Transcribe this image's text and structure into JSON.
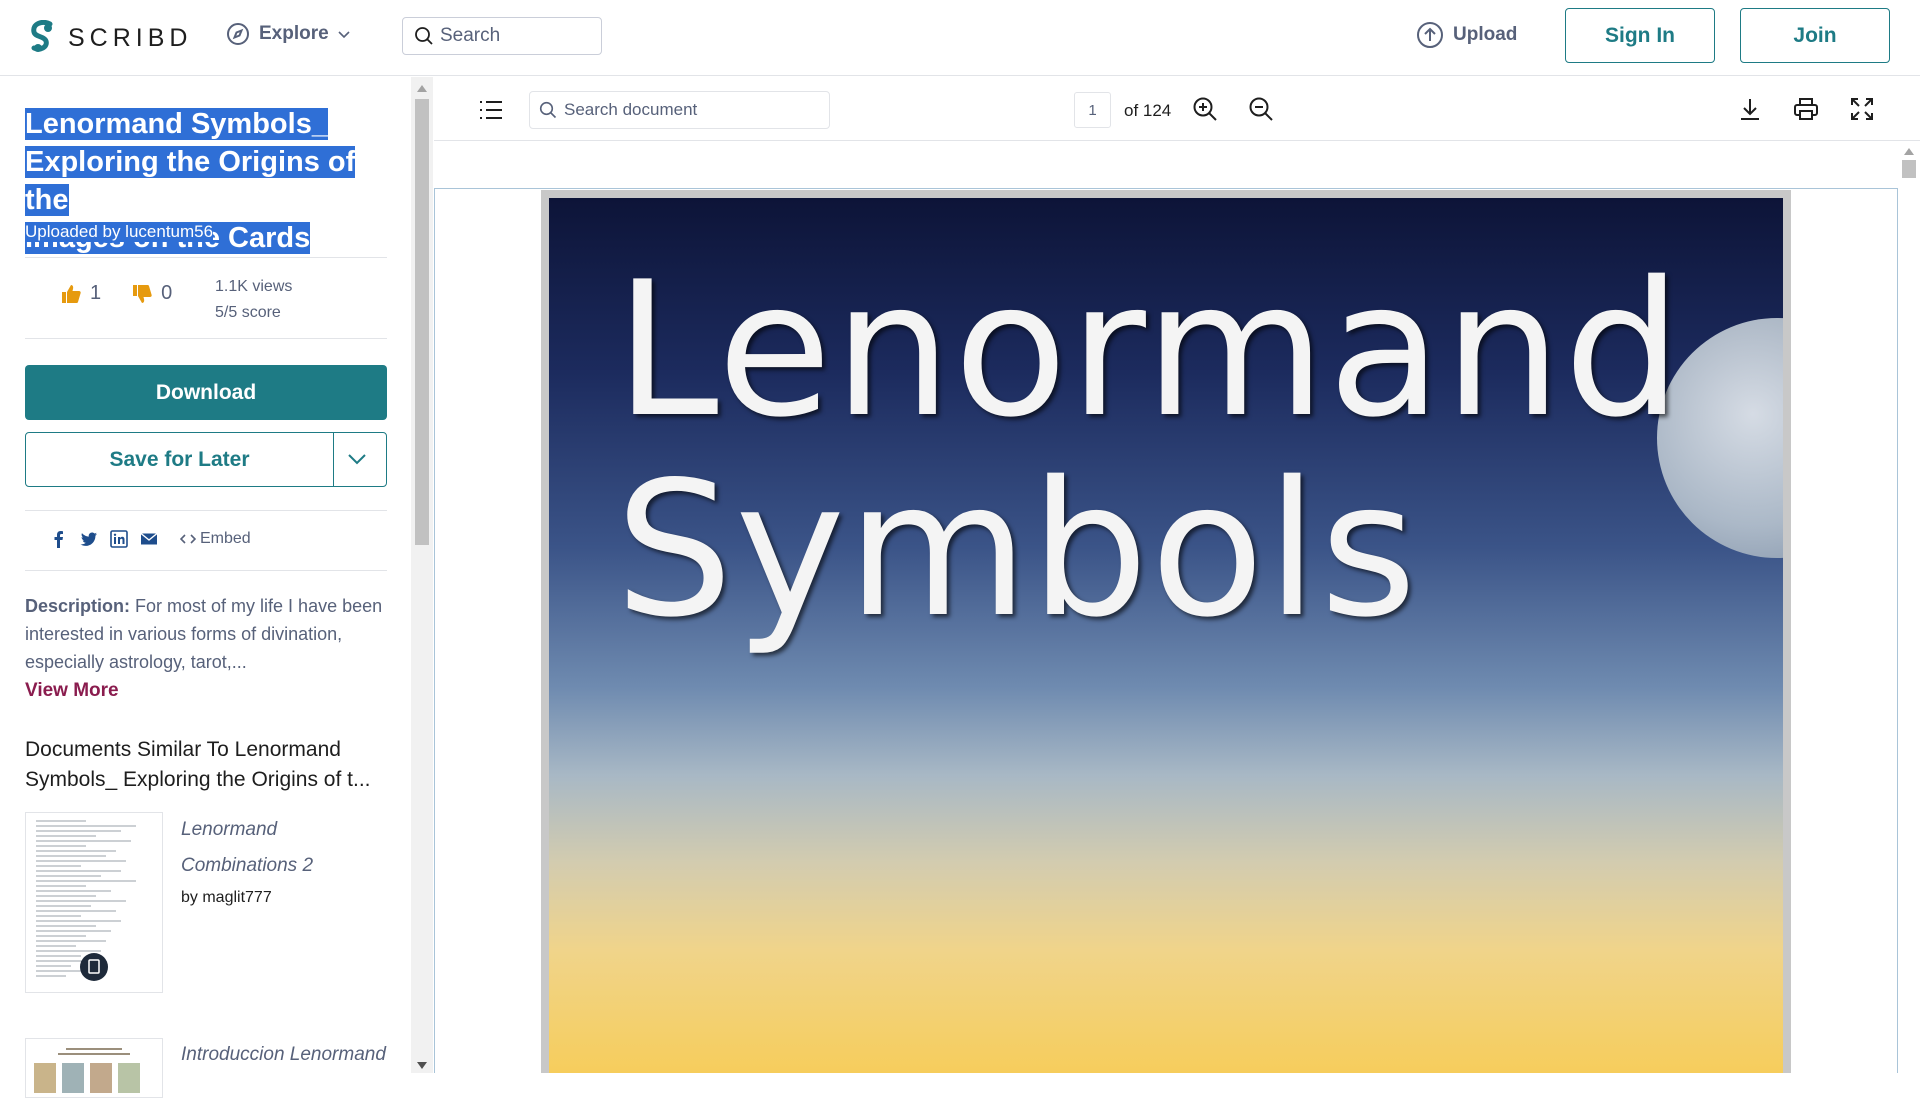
{
  "header": {
    "logo_text": "SCRIBD",
    "explore_label": "Explore",
    "search_placeholder": "Search",
    "upload_label": "Upload",
    "signin_label": "Sign In",
    "join_label": "Join"
  },
  "sidebar": {
    "title_lines": [
      "Lenormand Symbols_",
      "Exploring the Origins of the",
      "Images on the Cards"
    ],
    "uploaded_by": "Uploaded by lucentum56",
    "likes": "1",
    "dislikes": "0",
    "views": "1.1K views",
    "score": "5/5 score",
    "download_label": "Download",
    "save_label": "Save for Later",
    "embed_label": "Embed",
    "description_label": "Description:",
    "description_text": "For most of my life I have been interested in various forms of divination, especially astrology, tarot,...",
    "view_more": "View More",
    "similar_heading": "Documents Similar To Lenormand Symbols_ Exploring the Origins of t...",
    "related": [
      {
        "title": "Lenormand Combinations 2",
        "author": "by maglit777"
      },
      {
        "title": "Introduccion Lenormand",
        "author": ""
      }
    ]
  },
  "viewer": {
    "search_placeholder": "Search document",
    "page_number": "1",
    "page_total": "of 124",
    "cover_line1": "Lenormand",
    "cover_line2": "Symbols"
  },
  "colors": {
    "brand_teal": "#1e7b85",
    "selection_blue": "#2f6fd6",
    "view_more": "#8a1c4e"
  }
}
